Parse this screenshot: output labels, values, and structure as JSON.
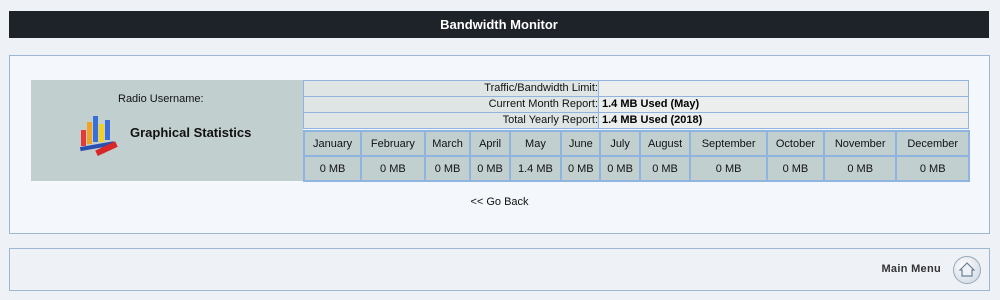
{
  "header": {
    "title": "Bandwidth Monitor"
  },
  "profile": {
    "radio_username_label": "Radio Username:",
    "radio_username_value": "",
    "graphical_statistics": "Graphical Statistics"
  },
  "summary": {
    "limit_label": "Traffic/Bandwidth Limit:",
    "limit_value": "",
    "month_label": "Current Month Report:",
    "month_value": "1.4 MB Used (May)",
    "year_label": "Total Yearly Report:",
    "year_value": "1.4 MB Used (2018)"
  },
  "months": [
    {
      "name": "January",
      "value": "0 MB"
    },
    {
      "name": "February",
      "value": "0 MB"
    },
    {
      "name": "March",
      "value": "0 MB"
    },
    {
      "name": "April",
      "value": "0 MB"
    },
    {
      "name": "May",
      "value": "1.4 MB"
    },
    {
      "name": "June",
      "value": "0 MB"
    },
    {
      "name": "July",
      "value": "0 MB"
    },
    {
      "name": "August",
      "value": "0 MB"
    },
    {
      "name": "September",
      "value": "0 MB"
    },
    {
      "name": "October",
      "value": "0 MB"
    },
    {
      "name": "November",
      "value": "0 MB"
    },
    {
      "name": "December",
      "value": "0 MB"
    }
  ],
  "nav": {
    "go_back": "<< Go Back"
  },
  "footer": {
    "main_menu": "Main Menu",
    "home_icon": "home-icon"
  }
}
